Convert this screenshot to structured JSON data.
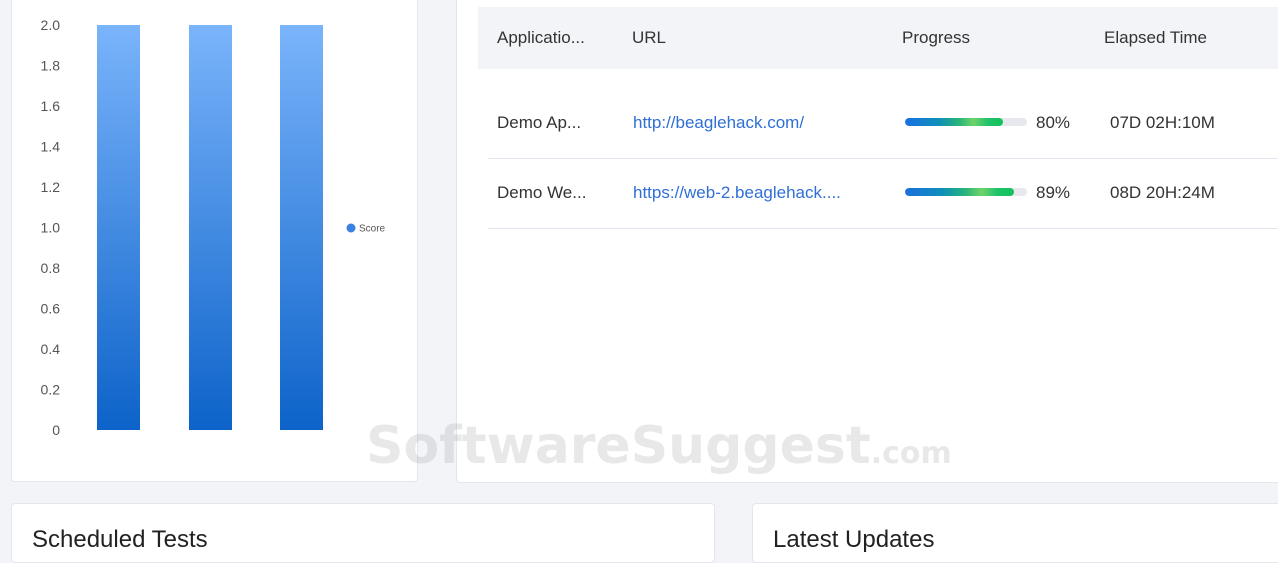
{
  "chart_data": {
    "type": "bar",
    "categories": [
      "",
      "",
      ""
    ],
    "series": [
      {
        "name": "Score",
        "values": [
          2.0,
          2.0,
          2.0
        ]
      }
    ],
    "y_ticks": [
      "0",
      "0.2",
      "0.4",
      "0.6",
      "0.8",
      "1.0",
      "1.2",
      "1.4",
      "1.6",
      "1.8",
      "2.0"
    ],
    "ylim": [
      0,
      2.0
    ],
    "legend": "right",
    "grid": false,
    "colors": {
      "bar_top": "#7ab4fb",
      "bar_bottom": "#0d63c9",
      "legend_dot": "#3b82e0"
    }
  },
  "table": {
    "headers": [
      "Applicatio...",
      "URL",
      "Progress",
      "Elapsed Time"
    ],
    "rows": [
      {
        "app": "Demo Ap...",
        "url": "http://beaglehack.com/",
        "progress": 0.8,
        "progress_label": "80%",
        "elapsed": "07D 02H:10M"
      },
      {
        "app": "Demo We...",
        "url": "https://web-2.beaglehack....",
        "progress": 0.89,
        "progress_label": "89%",
        "elapsed": "08D 20H:24M"
      }
    ]
  },
  "panels": {
    "scheduled_title": "Scheduled Tests",
    "updates_title": "Latest Updates"
  },
  "watermark": {
    "main": "SoftwareSuggest",
    "suffix": ".com"
  }
}
